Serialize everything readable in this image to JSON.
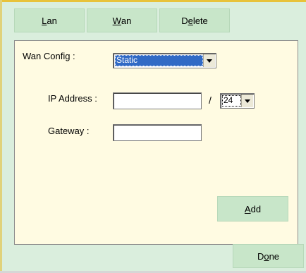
{
  "tabs": {
    "lan": {
      "pre": "",
      "key": "L",
      "post": "an"
    },
    "wan": {
      "pre": "",
      "key": "W",
      "post": "an"
    },
    "delete": {
      "pre": "D",
      "key": "e",
      "post": "lete"
    }
  },
  "wan_config": {
    "label": "Wan Config :",
    "selected": "Static"
  },
  "ip_address": {
    "label": "IP Address :",
    "value": "",
    "separator": "/",
    "prefix": "24"
  },
  "gateway": {
    "label": "Gateway :",
    "value": ""
  },
  "buttons": {
    "add": {
      "pre": "",
      "key": "A",
      "post": "dd"
    },
    "done": {
      "pre": "D",
      "key": "o",
      "post": "ne"
    }
  },
  "colors": {
    "background": "#daeedd",
    "panel": "#fffbe2",
    "button": "#c8e6c9",
    "selection": "#316ac5"
  }
}
